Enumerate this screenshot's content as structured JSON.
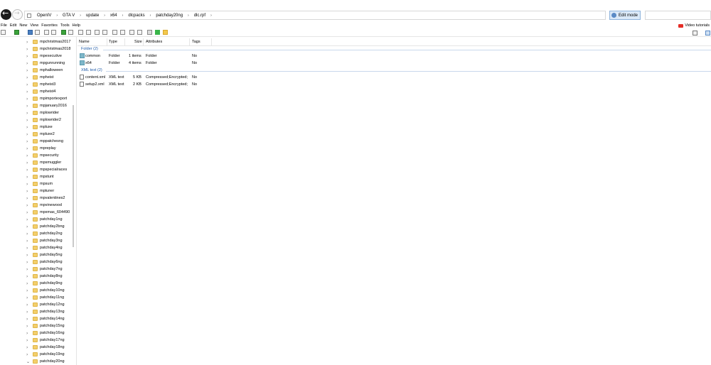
{
  "address_bar": {
    "breadcrumbs": [
      "OpenIV",
      "GTA V",
      "update",
      "x64",
      "dlcpacks",
      "patchday20ng",
      "dlc.rpf"
    ],
    "edit_mode_label": "Edit mode"
  },
  "menu": {
    "items": [
      "File",
      "Edit",
      "New",
      "View",
      "Favorites",
      "Tools",
      "Help"
    ],
    "video_tutorials": "Video tutorials"
  },
  "tree": {
    "items": [
      "mpchristmas2017",
      "mpchristmas2018",
      "mpexecutive",
      "mpgunrunning",
      "mphalloween",
      "mpheist",
      "mpheist3",
      "mpheist4",
      "mpimportexport",
      "mpjanuary2016",
      "mplowrider",
      "mplowrider2",
      "mpluxe",
      "mpluxe2",
      "mppatchesng",
      "mpreplay",
      "mpsecurity",
      "mpsmuggler",
      "mpspecialraces",
      "mpstunt",
      "mpsum",
      "mptuner",
      "mpvalentines2",
      "mpvinewood",
      "mpxmas_604490",
      "patchday1ng",
      "patchday2bng",
      "patchday2ng",
      "patchday3ng",
      "patchday4ng",
      "patchday5ng",
      "patchday6ng",
      "patchday7ng",
      "patchday8ng",
      "patchday9ng",
      "patchday10ng",
      "patchday11ng",
      "patchday12ng",
      "patchday13ng",
      "patchday14ng",
      "patchday15ng",
      "patchday16ng",
      "patchday17ng",
      "patchday18ng",
      "patchday19ng",
      "patchday20ng"
    ],
    "expanded_index": 45
  },
  "list": {
    "columns": [
      "Name",
      "Type",
      "Size",
      "Attributes",
      "Tags"
    ],
    "groups": [
      {
        "title": "Folder (2)",
        "rows": [
          {
            "name": "common",
            "type": "Folder",
            "size": "1 items",
            "attributes": "Folder",
            "tags": "No"
          },
          {
            "name": "x64",
            "type": "Folder",
            "size": "4 items",
            "attributes": "Folder",
            "tags": "No"
          }
        ]
      },
      {
        "title": "XML text (2)",
        "rows": [
          {
            "name": "content.xml",
            "type": "XML text",
            "size": "5 KB",
            "attributes": "Compressed;Encrypted;",
            "tags": "No"
          },
          {
            "name": "setup2.xml",
            "type": "XML text",
            "size": "2 KB",
            "attributes": "Compressed;Encrypted;",
            "tags": "No"
          }
        ]
      }
    ]
  }
}
